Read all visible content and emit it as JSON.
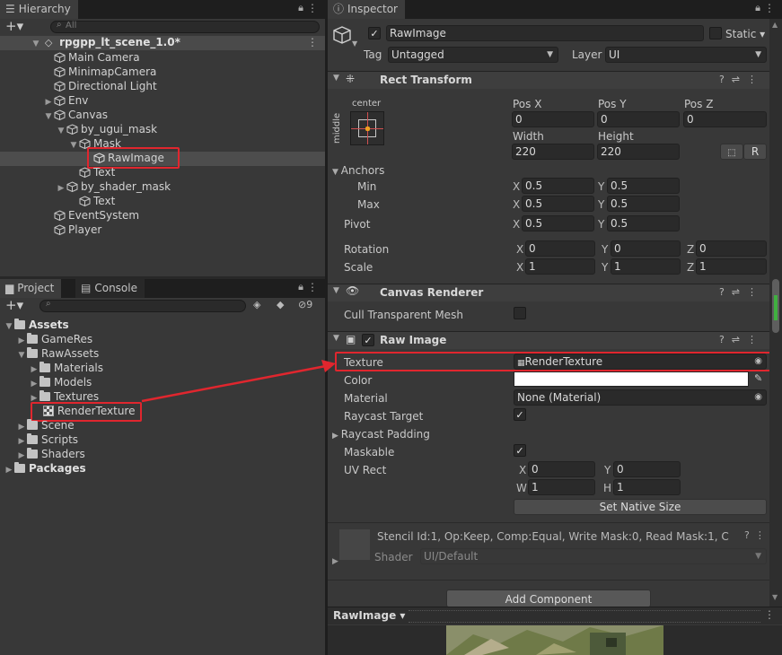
{
  "hierarchy": {
    "tab_label": "Hierarchy",
    "search_placeholder": "All",
    "scene_name": "rpgpp_lt_scene_1.0*",
    "items": [
      {
        "label": "Main Camera"
      },
      {
        "label": "MinimapCamera"
      },
      {
        "label": "Directional Light"
      },
      {
        "label": "Env"
      },
      {
        "label": "Canvas"
      },
      {
        "label": "by_ugui_mask"
      },
      {
        "label": "Mask"
      },
      {
        "label": "RawImage"
      },
      {
        "label": "Text"
      },
      {
        "label": "by_shader_mask"
      },
      {
        "label": "Text"
      },
      {
        "label": "EventSystem"
      },
      {
        "label": "Player"
      }
    ]
  },
  "project": {
    "tab_project": "Project",
    "tab_console": "Console",
    "hidden_count": "9",
    "items": [
      {
        "label": "Assets"
      },
      {
        "label": "GameRes"
      },
      {
        "label": "RawAssets"
      },
      {
        "label": "Materials"
      },
      {
        "label": "Models"
      },
      {
        "label": "Textures"
      },
      {
        "label": "RenderTexture"
      },
      {
        "label": "Scene"
      },
      {
        "label": "Scripts"
      },
      {
        "label": "Shaders"
      },
      {
        "label": "Packages"
      }
    ]
  },
  "inspector": {
    "tab_label": "Inspector",
    "object_name": "RawImage",
    "static_label": "Static",
    "tag_label": "Tag",
    "tag_value": "Untagged",
    "layer_label": "Layer",
    "layer_value": "UI",
    "rect_transform": {
      "title": "Rect Transform",
      "anchor_h": "center",
      "anchor_v": "middle",
      "pos_x_label": "Pos X",
      "pos_x": "0",
      "pos_y_label": "Pos Y",
      "pos_y": "0",
      "pos_z_label": "Pos Z",
      "pos_z": "0",
      "width_label": "Width",
      "width": "220",
      "height_label": "Height",
      "height": "220",
      "r_button": "R",
      "anchors_label": "Anchors",
      "min_label": "Min",
      "min_x": "0.5",
      "min_y": "0.5",
      "max_label": "Max",
      "max_x": "0.5",
      "max_y": "0.5",
      "pivot_label": "Pivot",
      "pivot_x": "0.5",
      "pivot_y": "0.5",
      "rotation_label": "Rotation",
      "rot_x": "0",
      "rot_y": "0",
      "rot_z": "0",
      "scale_label": "Scale",
      "scale_x": "1",
      "scale_y": "1",
      "scale_z": "1",
      "x": "X",
      "y": "Y",
      "z": "Z"
    },
    "canvas_renderer": {
      "title": "Canvas Renderer",
      "cull_label": "Cull Transparent Mesh"
    },
    "raw_image": {
      "title": "Raw Image",
      "texture_label": "Texture",
      "texture_value": "RenderTexture",
      "color_label": "Color",
      "material_label": "Material",
      "material_value": "None (Material)",
      "raycast_target_label": "Raycast Target",
      "raycast_padding_label": "Raycast Padding",
      "maskable_label": "Maskable",
      "uvrect_label": "UV Rect",
      "uv_x": "0",
      "uv_y": "0",
      "uv_w": "1",
      "uv_h": "1",
      "w": "W",
      "h": "H",
      "set_native_size": "Set Native Size"
    },
    "material_preview": {
      "stencil_text": "Stencil Id:1, Op:Keep, Comp:Equal, Write Mask:0, Read Mask:1, C",
      "shader_label": "Shader",
      "shader_value": "UI/Default"
    },
    "add_component": "Add Component",
    "preview_label": "RawImage"
  },
  "colors": {
    "panel": "#383838",
    "field": "#2a2a2a",
    "highlight": "#e0262e",
    "selected_row": "#4d4d4d"
  }
}
